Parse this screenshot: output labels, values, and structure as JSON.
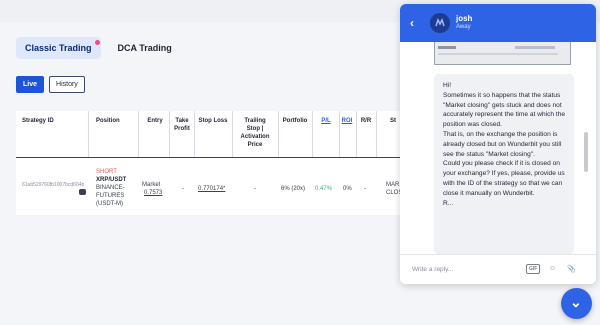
{
  "tabs": [
    {
      "label": "Classic Trading",
      "active": true
    },
    {
      "label": "DCA Trading",
      "active": false
    }
  ],
  "segments": [
    {
      "label": "Live",
      "active": true
    },
    {
      "label": "History",
      "active": false
    }
  ],
  "table": {
    "headers": {
      "strategy_id": "Strategy ID",
      "position": "Position",
      "entry": "Entry",
      "take_profit": "Take\nProfit",
      "stop_loss": "Stop Loss",
      "trailing": "Trailing\nStop |\nActivation\nPrice",
      "portfolio": "Portfolio",
      "pl": "P/L",
      "roi": "ROI",
      "rr": "R/R",
      "status": "St"
    },
    "row": {
      "strategy_id": "61ab529760fb1007bcd664b",
      "side": "SHORT",
      "pair": "XRP/USDT",
      "exchange": "BINANCE-\nFUTURES\n(USDT-M)",
      "entry_type": "Market",
      "entry_price": "0.7573",
      "take_profit": "-",
      "stop_loss": "0.770174",
      "stop_loss_star": "*",
      "trailing": "-",
      "portfolio": "6% (20x)",
      "pl": "0.47%",
      "roi": "0%",
      "rr": "-",
      "status": "MAR\nCLOS"
    }
  },
  "chat": {
    "agent_name": "josh",
    "agent_status": "Away",
    "message": "Hi!\nSometimes it so happens that the status \"Market closing\" gets stuck and does not accurately represent the time at which the position was closed.\nThat is, on the exchange the position is already closed but on Wunderbit you still see the status \"Market closing\".\nCould you please check if it is closed on your exchange? If yes, please, provide us with the ID of the strategy so that we can close it manually on Wunderbit.\nR...",
    "composer_placeholder": "Write a reply...",
    "gif_label": "GIF"
  },
  "colors": {
    "accent": "#2d63e4",
    "short": "#e05a63",
    "profit": "#3bb56b"
  },
  "icons": [
    "back-chevron-icon",
    "chat-avatar-icon",
    "gif-icon",
    "attachment-icon",
    "emoji-icon",
    "chevron-down-icon",
    "robot-icon"
  ]
}
